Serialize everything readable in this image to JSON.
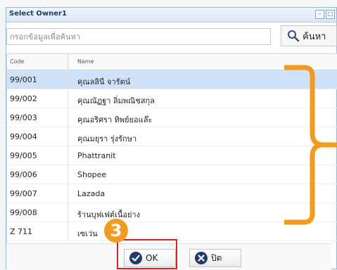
{
  "dialog": {
    "title": "Select Owner1"
  },
  "search": {
    "placeholder": "กรอกข้อมูลเพื่อค้นหา",
    "button_label": "ค้นหา"
  },
  "grid": {
    "columns": {
      "code": "Code",
      "name": "Name"
    },
    "rows": [
      {
        "code": "99/001",
        "name": "คุณลลินี จารัตน์",
        "selected": true
      },
      {
        "code": "99/002",
        "name": "คุณณัฏฐา ลิ่มพณิชสกุล"
      },
      {
        "code": "99/003",
        "name": "คุณอริศรา ทิพย์ยอแล๊ะ"
      },
      {
        "code": "99/004",
        "name": "คุณมยุรา รุ่งรักษา"
      },
      {
        "code": "99/005",
        "name": "Phattranit"
      },
      {
        "code": "99/006",
        "name": "Shopee"
      },
      {
        "code": "99/007",
        "name": "Lazada"
      },
      {
        "code": "99/008",
        "name": "ร้านบุฟเฟต์เนื้อย่าง"
      },
      {
        "code": "Z 711",
        "name": "เซเว่น"
      }
    ]
  },
  "footer": {
    "ok_label": "OK",
    "close_label": "ปิด"
  },
  "annotations": {
    "step_number": "3",
    "badge_color": "#f39b1e",
    "highlight_color": "#d8232a"
  }
}
